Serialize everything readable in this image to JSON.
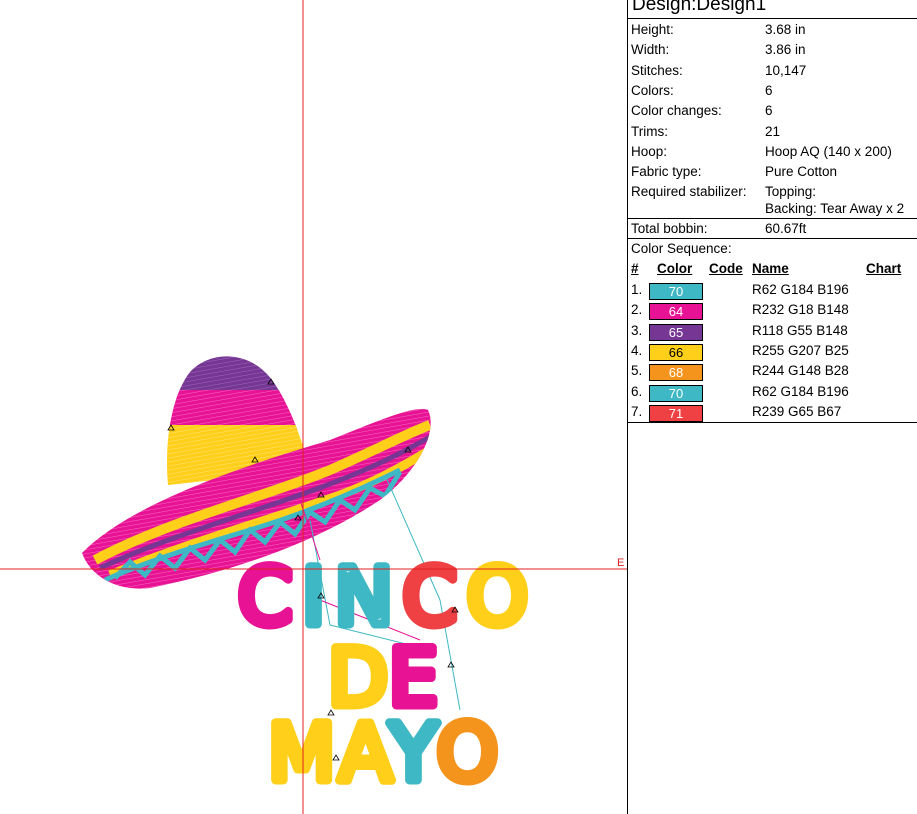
{
  "design": {
    "title": "Design:Design1",
    "specs": [
      {
        "label": "Height:",
        "value": "3.68 in"
      },
      {
        "label": "Width:",
        "value": "3.86 in"
      },
      {
        "label": "Stitches:",
        "value": "10,147"
      },
      {
        "label": "Colors:",
        "value": "6"
      },
      {
        "label": "Color changes:",
        "value": "6"
      },
      {
        "label": "Trims:",
        "value": "21"
      },
      {
        "label": "Hoop:",
        "value": "Hoop AQ (140 x 200)"
      },
      {
        "label": "Fabric type:",
        "value": "Pure Cotton"
      }
    ],
    "stabilizer": {
      "label": "Required stabilizer:",
      "line1": "Topping:",
      "line2": "Backing: Tear Away x 2"
    },
    "bobbin": {
      "label": "Total bobbin:",
      "value": "60.67ft"
    }
  },
  "sequence": {
    "heading": "Color Sequence:",
    "columns": {
      "num": "#",
      "color": "Color",
      "code": "Code",
      "name": "Name",
      "chart": "Chart"
    },
    "rows": [
      {
        "num": "1.",
        "code": "70",
        "name": "R62 G184 B196",
        "hex": "#3eb8c4"
      },
      {
        "num": "2.",
        "code": "64",
        "name": "R232 G18 B148",
        "hex": "#e81294"
      },
      {
        "num": "3.",
        "code": "65",
        "name": "R118 G55 B148",
        "hex": "#763794"
      },
      {
        "num": "4.",
        "code": "66",
        "name": "R255 G207 B25",
        "hex": "#ffcf19"
      },
      {
        "num": "5.",
        "code": "68",
        "name": "R244 G148 B28",
        "hex": "#f4941c"
      },
      {
        "num": "6.",
        "code": "70",
        "name": "R62 G184 B196",
        "hex": "#3eb8c4"
      },
      {
        "num": "7.",
        "code": "71",
        "name": "R239 G65 B67",
        "hex": "#ef4143"
      }
    ]
  },
  "canvas": {
    "axis_label_e": "E",
    "artwork": [
      "CINCO",
      "DE",
      "MAYO"
    ]
  }
}
